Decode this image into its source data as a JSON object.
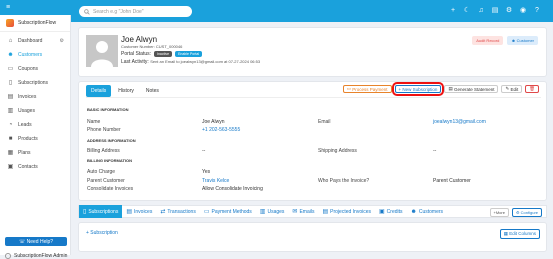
{
  "header": {
    "search_placeholder": "Search e.g \"John Doe\""
  },
  "sidebar": {
    "brand": "SubscriptionFlow",
    "items": [
      {
        "label": "Dashboard",
        "icon": "home-icon"
      },
      {
        "label": "Customers",
        "icon": "users-icon",
        "active": true
      },
      {
        "label": "Coupons",
        "icon": "ticket-icon"
      },
      {
        "label": "Subscriptions",
        "icon": "document-icon"
      },
      {
        "label": "Invoices",
        "icon": "invoice-icon"
      },
      {
        "label": "Usages",
        "icon": "chart-icon"
      },
      {
        "label": "Leads",
        "icon": "leads-icon"
      },
      {
        "label": "Products",
        "icon": "box-icon"
      },
      {
        "label": "Plans",
        "icon": "plans-icon"
      },
      {
        "label": "Contacts",
        "icon": "contacts-icon"
      }
    ],
    "need_help": "Need Help?",
    "admin": "SubscriptionFlow Admin"
  },
  "profile": {
    "name": "Joe Alwyn",
    "customer_number": "Customer Number: CUST_000046",
    "portal_status_label": "Portal Status:",
    "portal_status_value": "Inactive",
    "enable_portal": "Enable Portal",
    "last_activity_label": "Last Activity:",
    "last_activity_value": "Sent an Email to joealwyn13@gmail.com at 07-27-2024 06:53",
    "audit_record": "Audit Record",
    "customer_badge": "Customer"
  },
  "details": {
    "tabs": [
      "Details",
      "History",
      "Notes"
    ],
    "actions": {
      "process_payment": "Process Payment",
      "new_subscription": "New Subscription",
      "generate_statement": "Generate Statement",
      "edit": "Edit"
    },
    "sections": {
      "basic": "BASIC INFORMATION",
      "address": "ADDRESS INFORMATION",
      "billing": "BILLING INFORMATION"
    },
    "fields": {
      "name_label": "Name",
      "name_value": "Joe Alwyn",
      "email_label": "Email",
      "email_value": "joealwyn13@gmail.com",
      "phone_label": "Phone Number",
      "phone_value": "+1 202-563-5555",
      "billing_address_label": "Billing Address",
      "billing_address_value": "--",
      "shipping_address_label": "Shipping Address",
      "shipping_address_value": "--",
      "auto_charge_label": "Auto Charge",
      "auto_charge_value": "Yes",
      "parent_customer_label": "Parent Customer",
      "parent_customer_value": "Travis Kelce",
      "who_pays_label": "Who Pays the Invoice?",
      "who_pays_value": "Parent Customer",
      "consolidate_label": "Consolidate Invoices",
      "consolidate_value": "Allow Consolidate Invoicing"
    }
  },
  "related": {
    "tabs": [
      "Subscriptions",
      "Invoices",
      "Transactions",
      "Payment Methods",
      "Usages",
      "Emails",
      "Projected Invoices",
      "Credits",
      "Customers"
    ],
    "more": "+More",
    "configure": "Configure",
    "add_subscription": "+ Subscription",
    "edit_columns": "Edit Columns"
  },
  "colors": {
    "accent": "#1aa1dc",
    "highlight": "#e11111"
  }
}
